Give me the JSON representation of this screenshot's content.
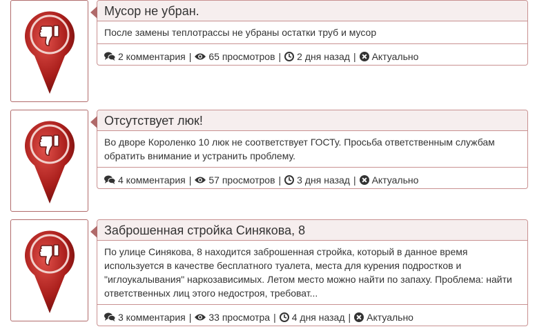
{
  "items": [
    {
      "title": "Мусор не убран.",
      "description": "После замены теплотрассы не убраны остатки труб и мусор",
      "comments": "2 комментария",
      "views": "65 просмотров",
      "time": "2 дня назад",
      "status": "Актуально"
    },
    {
      "title": "Отсутствует люк!",
      "description": "Во дворе Короленко 10 люк не соответствует ГОСТу. Просьба ответственным службам обратить внимание и устранить проблему.",
      "comments": "4 комментария",
      "views": "57 просмотров",
      "time": "3 дня назад",
      "status": "Актуально"
    },
    {
      "title": "Заброшенная стройка Синякова, 8",
      "description": "По улице Синякова, 8 находится заброшенная стройка, который в данное время используется в качестве бесплатного туалета, места для курения подростков и \"иглоукалывания\" наркозависимых. Летом место можно найти по запаху. Проблема: найти ответственных лиц этого недостроя, требоват...",
      "comments": "3 комментария",
      "views": "33 просмотра",
      "time": "4 дня назад",
      "status": "Актуально"
    }
  ],
  "separator": "|",
  "icons": {
    "pin": "thumbs-down-map-pin-icon",
    "comments": "comments-icon",
    "views": "eye-icon",
    "time": "clock-icon",
    "status": "times-circle-icon"
  },
  "colors": {
    "pin": "#b3221f",
    "border": "#c89090",
    "title_bg": "#f6eeee"
  }
}
